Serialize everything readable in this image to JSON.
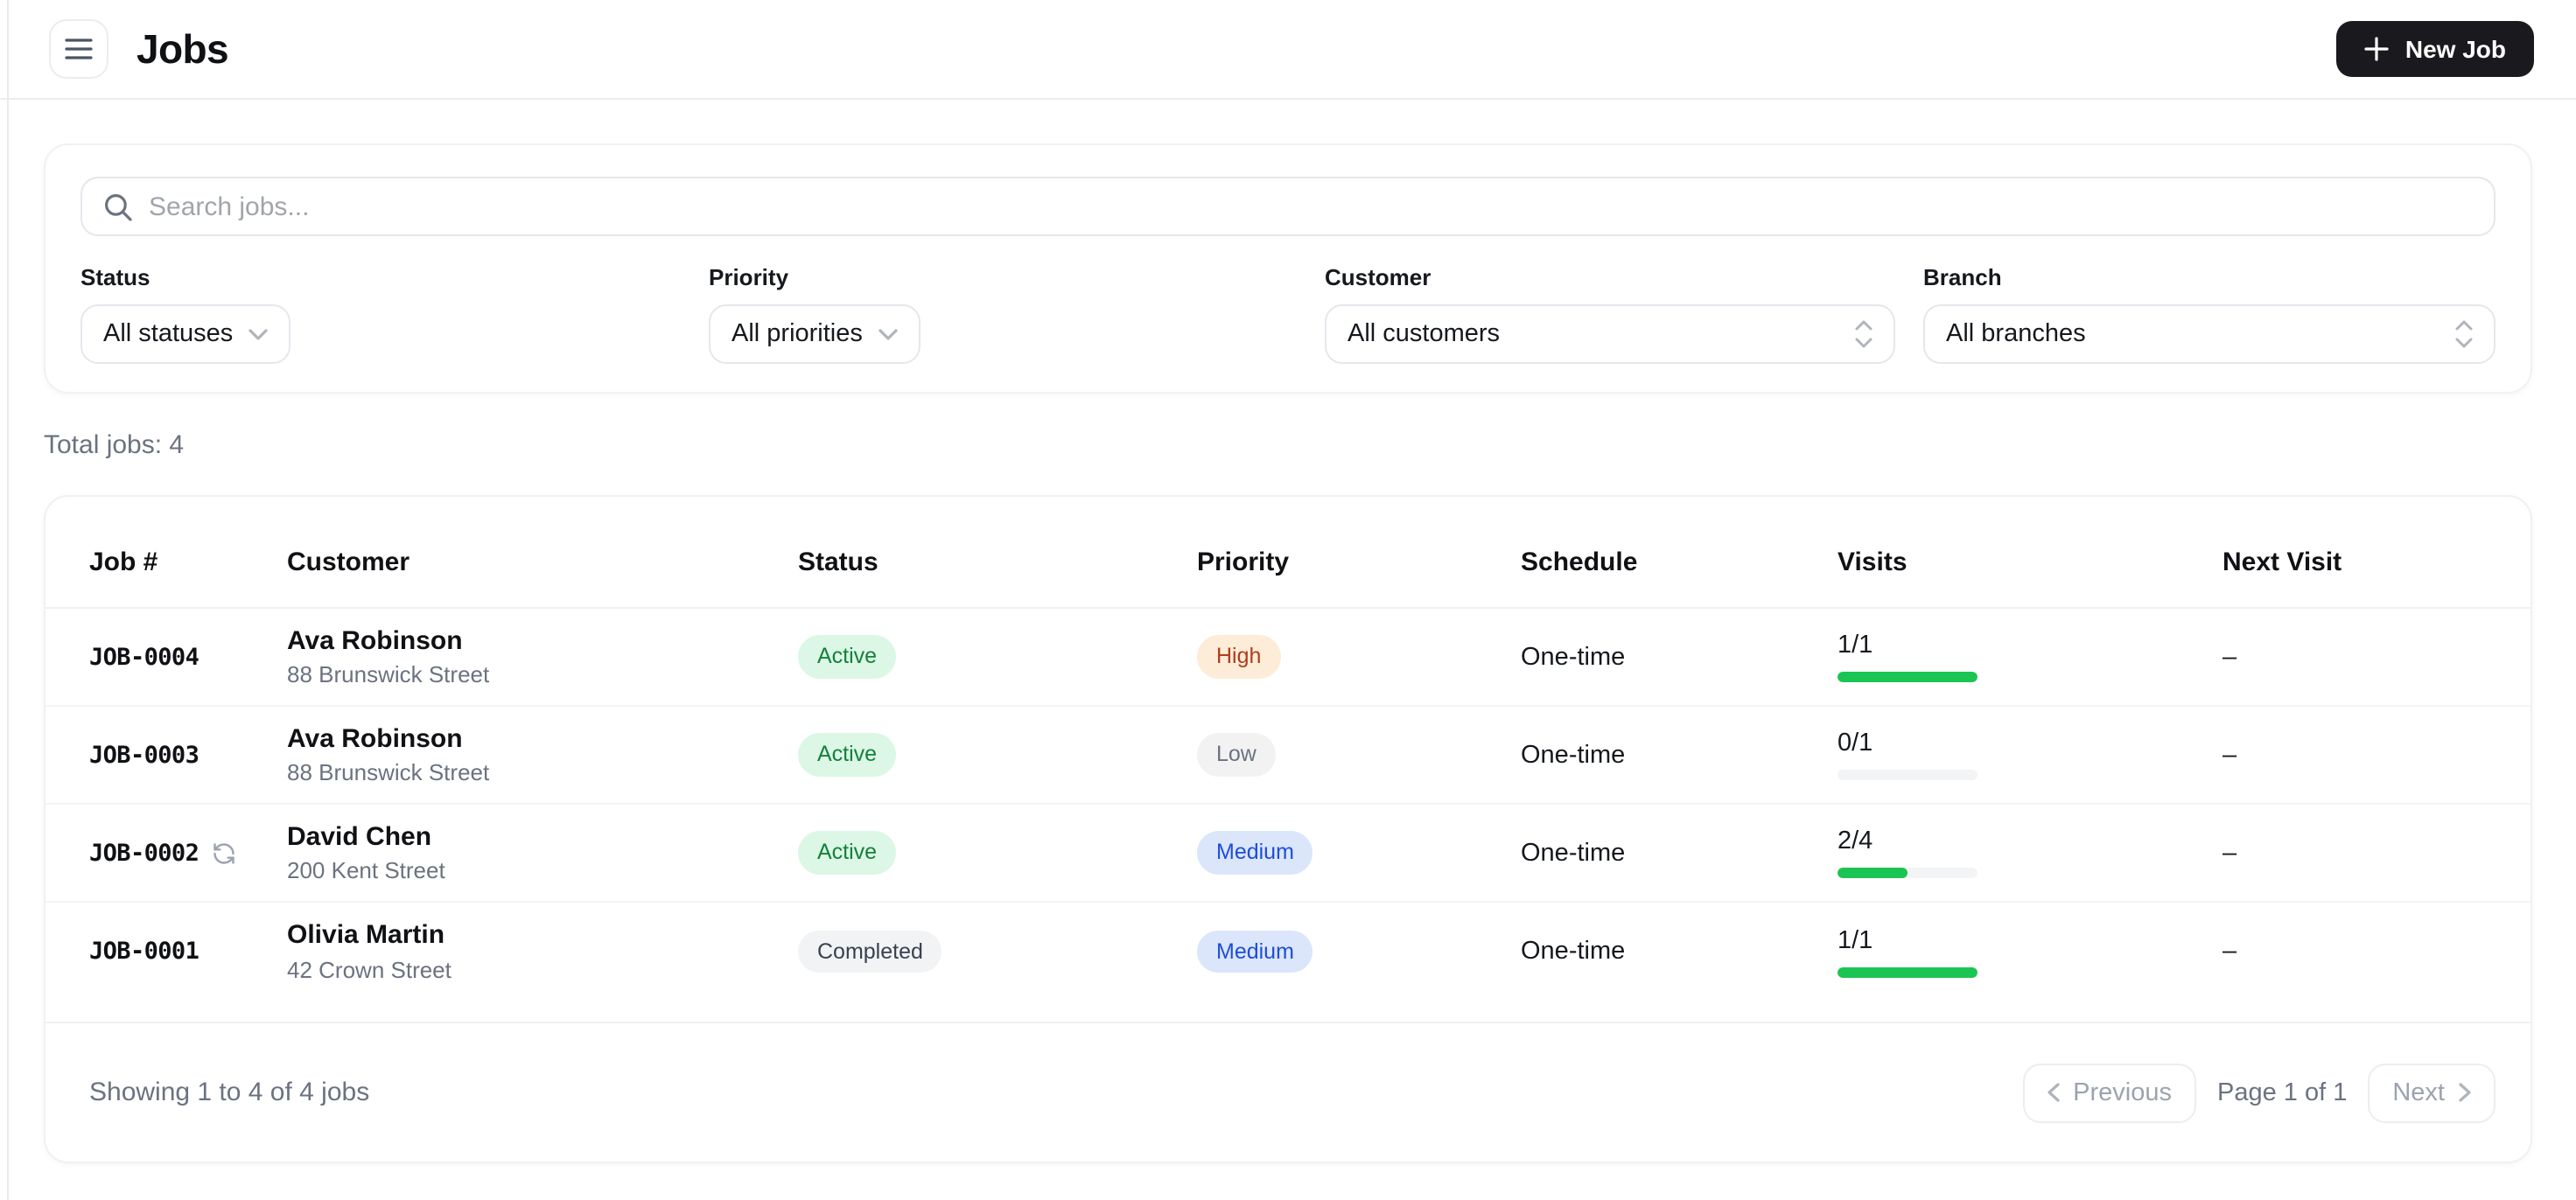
{
  "header": {
    "title": "Jobs",
    "new_job_label": "New Job"
  },
  "filters": {
    "search_placeholder": "Search jobs...",
    "status": {
      "label": "Status",
      "value": "All statuses"
    },
    "priority": {
      "label": "Priority",
      "value": "All priorities"
    },
    "customer": {
      "label": "Customer",
      "value": "All customers"
    },
    "branch": {
      "label": "Branch",
      "value": "All branches"
    }
  },
  "summary": {
    "total_label": "Total jobs: 4"
  },
  "table": {
    "columns": [
      "Job #",
      "Customer",
      "Status",
      "Priority",
      "Schedule",
      "Visits",
      "Next Visit"
    ],
    "rows": [
      {
        "job_number": "JOB-0004",
        "recurring": false,
        "customer": "Ava Robinson",
        "address": "88 Brunswick Street",
        "status": "Active",
        "priority": "High",
        "schedule": "One-time",
        "visits": "1/1",
        "visits_pct": 100,
        "next_visit": "–"
      },
      {
        "job_number": "JOB-0003",
        "recurring": false,
        "customer": "Ava Robinson",
        "address": "88 Brunswick Street",
        "status": "Active",
        "priority": "Low",
        "schedule": "One-time",
        "visits": "0/1",
        "visits_pct": 0,
        "next_visit": "–"
      },
      {
        "job_number": "JOB-0002",
        "recurring": true,
        "customer": "David Chen",
        "address": "200 Kent Street",
        "status": "Active",
        "priority": "Medium",
        "schedule": "One-time",
        "visits": "2/4",
        "visits_pct": 50,
        "next_visit": "–"
      },
      {
        "job_number": "JOB-0001",
        "recurring": false,
        "customer": "Olivia Martin",
        "address": "42 Crown Street",
        "status": "Completed",
        "priority": "Medium",
        "schedule": "One-time",
        "visits": "1/1",
        "visits_pct": 100,
        "next_visit": "–"
      }
    ]
  },
  "pagination": {
    "showing": "Showing 1 to 4 of 4 jobs",
    "previous_label": "Previous",
    "page_info": "Page 1 of 1",
    "next_label": "Next"
  },
  "colors": {
    "accent_dark": "#1a1a1e",
    "progress_fill": "#1bc553",
    "progress_track": "#f3f4f6",
    "status": {
      "Active": {
        "bg": "#dcf7e5",
        "fg": "#15803d"
      },
      "Completed": {
        "bg": "#f2f3f4",
        "fg": "#374151"
      }
    },
    "priority": {
      "High": {
        "bg": "#fdecd7",
        "fg": "#b03c1e"
      },
      "Medium": {
        "bg": "#dbe6fb",
        "fg": "#1d4ed8"
      },
      "Low": {
        "bg": "#f2f2f3",
        "fg": "#6b7280"
      }
    }
  }
}
